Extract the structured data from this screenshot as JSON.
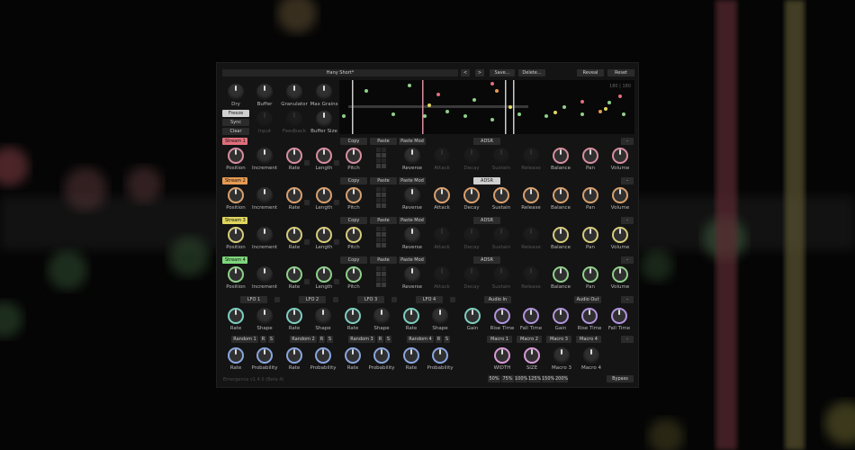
{
  "topbar": {
    "preset_name": "Hany Short*",
    "prev": "<",
    "next": ">",
    "save": "Save...",
    "delete": "Delete...",
    "reveal": "Reveal",
    "reset": "Reset"
  },
  "main_knobs": {
    "dry": "Dry",
    "buffer": "Buffer",
    "granulator": "Granulator",
    "max_grains": "Max Grains",
    "input": "Input",
    "feedback": "Feedback",
    "buffer_size": "Buffer Size"
  },
  "mode_buttons": {
    "freeze": "Freeze",
    "sync": "Sync",
    "clear": "Clear"
  },
  "viz": {
    "counter": "180 | 180"
  },
  "streams": [
    {
      "name": "Stream 1",
      "color": "#e06f7b"
    },
    {
      "name": "Stream 2",
      "color": "#e79a52"
    },
    {
      "name": "Stream 3",
      "color": "#e0d65e"
    },
    {
      "name": "Stream 4",
      "color": "#7fd67c"
    }
  ],
  "stream_controls": {
    "position": "Position",
    "increment": "Increment",
    "rate": "Rate",
    "length": "Length",
    "pitch": "Pitch",
    "copy": "Copy",
    "paste": "Paste",
    "paste_mod": "Paste Mod",
    "adsr": "ADSR",
    "reverse": "Reverse",
    "attack": "Attack",
    "decay": "Decay",
    "sustain": "Sustain",
    "release": "Release",
    "balance": "Balance",
    "pan": "Pan",
    "volume": "Volume",
    "dash": "-"
  },
  "lfos": [
    {
      "name": "LFO 1"
    },
    {
      "name": "LFO 2"
    },
    {
      "name": "LFO 3"
    },
    {
      "name": "LFO 4"
    }
  ],
  "lfo_labels": {
    "rate": "Rate",
    "shape": "Shape"
  },
  "audio_in": {
    "title": "Audio In",
    "gain": "Gain",
    "rise_time": "Rise Time",
    "fall_time": "Fall Time"
  },
  "audio_out": {
    "title": "Audio Out",
    "gain": "Gain",
    "rise_time": "Rise Time",
    "fall_time": "Fall Time",
    "dash": "-"
  },
  "randoms": [
    {
      "name": "Random 1"
    },
    {
      "name": "Random 2"
    },
    {
      "name": "Random 3"
    },
    {
      "name": "Random 4"
    }
  ],
  "random_labels": {
    "rate": "Rate",
    "probability": "Probability",
    "r": "R",
    "s": "S"
  },
  "macros": [
    {
      "name": "Macro 1",
      "label": "WIDTH"
    },
    {
      "name": "Macro 2",
      "label": "SIZE"
    },
    {
      "name": "Macro 3",
      "label": "Macro 3"
    },
    {
      "name": "Macro 4",
      "label": "Macro 4"
    }
  ],
  "macro_dash": "-",
  "footer": {
    "version": "Emergence v1.4.0 (Beta 4)",
    "zoom": [
      "50%",
      "75%",
      "100%",
      "125%",
      "150%",
      "200%"
    ],
    "bypass": "Bypass"
  }
}
